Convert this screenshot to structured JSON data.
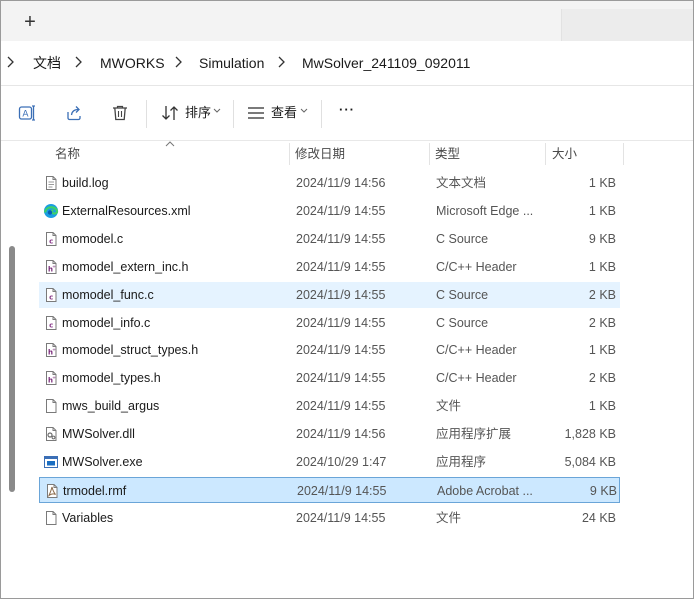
{
  "tabstrip": {
    "new_tab_symbol": "+"
  },
  "breadcrumb": {
    "items": [
      "文档",
      "MWORKS",
      "Simulation",
      "MwSolver_241109_092011"
    ]
  },
  "toolbar": {
    "sort_label": "排序",
    "view_label": "查看",
    "more_label": "···"
  },
  "columns": {
    "name": "名称",
    "date": "修改日期",
    "type": "类型",
    "size": "大小"
  },
  "files": [
    {
      "name": "build.log",
      "date": "2024/11/9 14:56",
      "type": "文本文档",
      "size": "1 KB",
      "icon": "text-file-icon"
    },
    {
      "name": "ExternalResources.xml",
      "date": "2024/11/9 14:55",
      "type": "Microsoft Edge ...",
      "size": "1 KB",
      "icon": "edge-icon"
    },
    {
      "name": "momodel.c",
      "date": "2024/11/9 14:55",
      "type": "C Source",
      "size": "9 KB",
      "icon": "c-source-icon"
    },
    {
      "name": "momodel_extern_inc.h",
      "date": "2024/11/9 14:55",
      "type": "C/C++ Header",
      "size": "1 KB",
      "icon": "c-header-icon"
    },
    {
      "name": "momodel_func.c",
      "date": "2024/11/9 14:55",
      "type": "C Source",
      "size": "2 KB",
      "icon": "c-source-icon",
      "state": "hover"
    },
    {
      "name": "momodel_info.c",
      "date": "2024/11/9 14:55",
      "type": "C Source",
      "size": "2 KB",
      "icon": "c-source-icon"
    },
    {
      "name": "momodel_struct_types.h",
      "date": "2024/11/9 14:55",
      "type": "C/C++ Header",
      "size": "1 KB",
      "icon": "c-header-icon"
    },
    {
      "name": "momodel_types.h",
      "date": "2024/11/9 14:55",
      "type": "C/C++ Header",
      "size": "2 KB",
      "icon": "c-header-icon"
    },
    {
      "name": "mws_build_argus",
      "date": "2024/11/9 14:55",
      "type": "文件",
      "size": "1 KB",
      "icon": "blank-file-icon"
    },
    {
      "name": "MWSolver.dll",
      "date": "2024/11/9 14:56",
      "type": "应用程序扩展",
      "size": "1,828 KB",
      "icon": "dll-file-icon"
    },
    {
      "name": "MWSolver.exe",
      "date": "2024/10/29 1:47",
      "type": "应用程序",
      "size": "5,084 KB",
      "icon": "exe-file-icon"
    },
    {
      "name": "trmodel.rmf",
      "date": "2024/11/9 14:55",
      "type": "Adobe Acrobat ...",
      "size": "9 KB",
      "icon": "acrobat-file-icon",
      "state": "selected"
    },
    {
      "name": "Variables",
      "date": "2024/11/9 14:55",
      "type": "文件",
      "size": "24 KB",
      "icon": "blank-file-icon"
    }
  ]
}
